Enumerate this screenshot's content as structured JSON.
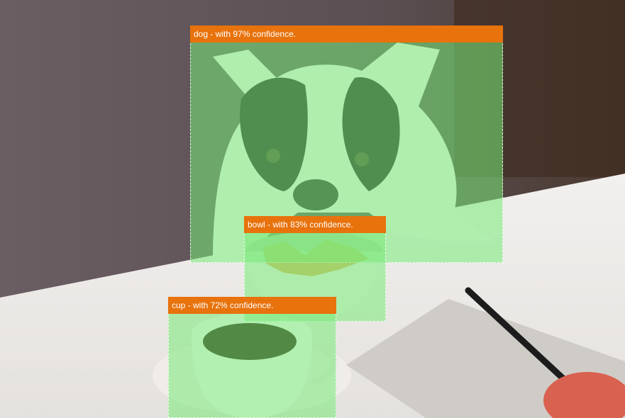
{
  "detections": [
    {
      "label": "dog - with 97% confidence.",
      "object": "dog",
      "confidence": 97
    },
    {
      "label": "bowl - with 83% confidence.",
      "object": "bowl",
      "confidence": 83
    },
    {
      "label": "cup - with 72% confidence.",
      "object": "cup",
      "confidence": 72
    }
  ],
  "colors": {
    "label_bg": "#e8720c",
    "overlay": "#78eb78",
    "label_text": "#ffffff"
  }
}
